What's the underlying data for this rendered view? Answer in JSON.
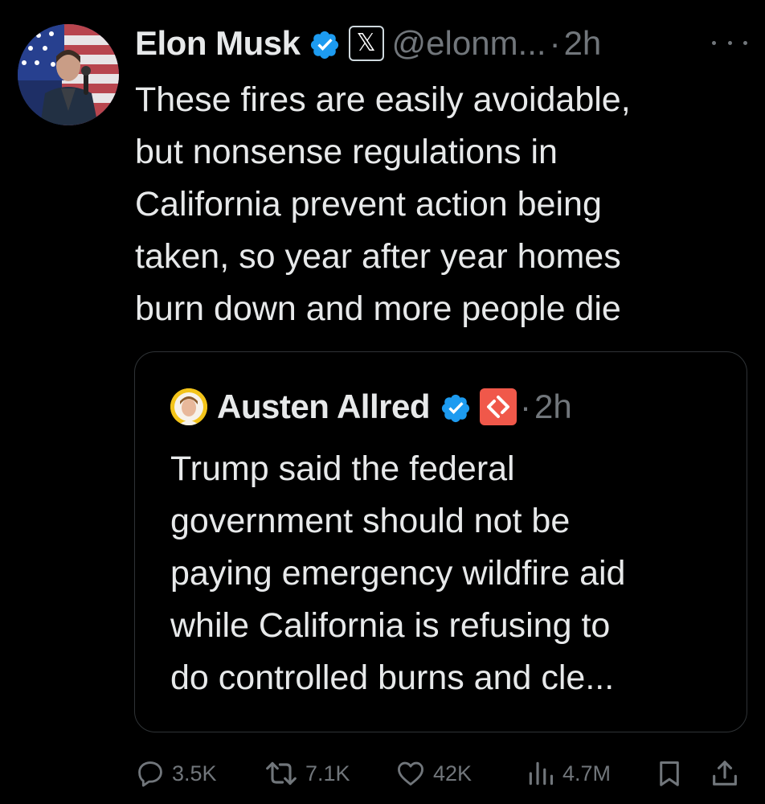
{
  "tweet": {
    "author_name": "Elon Musk",
    "handle": "@elonm...",
    "separator": "·",
    "time": "2h",
    "affiliation_badge": "𝕏",
    "text_lines": [
      "These fires are easily avoidable,",
      "but nonsense regulations in",
      "California prevent action being",
      "taken, so year after year homes",
      "burn down and more people die"
    ]
  },
  "quote": {
    "author_name": "Austen Allred",
    "separator": "·",
    "time": "2h",
    "text_lines": [
      "Trump said the federal",
      "government should not be",
      "paying emergency wildfire aid",
      "while California is refusing to",
      "do controlled burns and cle..."
    ]
  },
  "actions": {
    "replies": "3.5K",
    "reposts": "7.1K",
    "likes": "42K",
    "views": "4.7M"
  },
  "colors": {
    "background": "#000000",
    "text": "#e7e9ea",
    "secondary": "#71767b",
    "verified_blue": "#1d9bf0",
    "card_border": "#2f3336",
    "quote_affiliation": "#f0584a"
  },
  "icons": [
    "more-icon",
    "verified-badge-icon",
    "x-logo-icon",
    "reply-icon",
    "repost-icon",
    "like-icon",
    "views-icon",
    "bookmark-icon",
    "share-icon"
  ]
}
